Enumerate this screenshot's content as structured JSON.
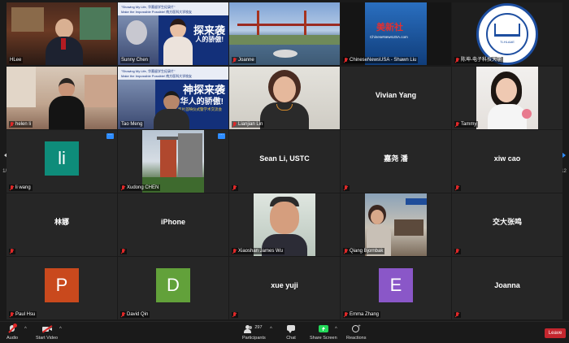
{
  "pagination": {
    "left_label": "1/12",
    "right_label": "1/12"
  },
  "tiles": [
    {
      "name": "HLee",
      "muted": false
    },
    {
      "name": "Sunny Chen",
      "muted": false
    },
    {
      "name": "Joanne",
      "muted": true
    },
    {
      "name": "ChineseNewsUSA - Shawn Liu",
      "muted": true
    },
    {
      "name": "陈坤-电子科技大学",
      "muted": true
    },
    {
      "name": "helen li",
      "muted": true
    },
    {
      "name": "Tao Meng",
      "muted": false
    },
    {
      "name": "Lianjian Lin",
      "muted": true
    },
    {
      "name": "Vivian Yang",
      "muted": false
    },
    {
      "name": "Tammy",
      "muted": true
    },
    {
      "name": "li wang",
      "muted": true,
      "avatar": "li",
      "avatar_color": "#0e8c7a"
    },
    {
      "name": "Xudong CHEN",
      "muted": true
    },
    {
      "name": "Sean Li, USTC",
      "muted": true
    },
    {
      "name": "嘉尧 潘",
      "muted": true
    },
    {
      "name": "xiw cao",
      "muted": true
    },
    {
      "name": "林娜",
      "muted": true
    },
    {
      "name": "iPhone",
      "muted": true
    },
    {
      "name": "Xiaoshan James Wu",
      "muted": true
    },
    {
      "name": "Qiang Bjornbak",
      "muted": true
    },
    {
      "name": "交大张鸣",
      "muted": true
    },
    {
      "name": "Paul Hsu",
      "muted": true,
      "avatar": "P",
      "avatar_color": "#c9491d"
    },
    {
      "name": "David Qin",
      "muted": true,
      "avatar": "D",
      "avatar_color": "#62a13a"
    },
    {
      "name": "xue yuji",
      "muted": true
    },
    {
      "name": "Emma Zhang",
      "muted": true,
      "avatar": "E",
      "avatar_color": "#8a57c8"
    },
    {
      "name": "Joanna",
      "muted": true
    }
  ],
  "slide_text": {
    "subtitle_a": "\"Showing My Life, 华裔留学生纪录片\"",
    "subtitle_b": "Make the Impossible Possible!  南方医科大学校友",
    "big_title": "探来袭",
    "big_title_2": "人的骄傲!",
    "big_title_alt": "神探来袭",
    "big_title_alt_2": "华人的骄傲!",
    "small_lines": "新片首映仪式暨学术交流会"
  },
  "logo_text": {
    "banner": "华人科技协会",
    "badge": "TLHLAAE",
    "news": "美新社",
    "news_sub": "ChineseNewsUSA.com"
  },
  "toolbar": {
    "audio": "Audio",
    "start_video": "Start Video",
    "participants": "Participants",
    "participants_count": "297",
    "chat": "Chat",
    "share_screen": "Share Screen",
    "reactions": "Reactions",
    "leave": "Leave"
  },
  "colors": {
    "active_speaker": "#f3e542",
    "share_green": "#23d959",
    "leave_red": "#c4262e",
    "nav_blue": "#2d8cff"
  }
}
